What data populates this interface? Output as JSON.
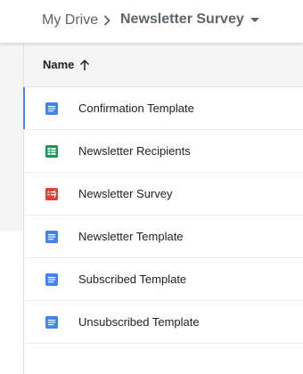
{
  "breadcrumb": {
    "root": "My Drive",
    "current": "Newsletter Survey"
  },
  "list": {
    "sort_label": "Name",
    "sort_direction": "ascending",
    "files": [
      {
        "name": "Confirmation Template",
        "type": "document",
        "selected": true
      },
      {
        "name": "Newsletter Recipients",
        "type": "spreadsheet",
        "selected": false
      },
      {
        "name": "Newsletter Survey",
        "type": "form",
        "selected": false
      },
      {
        "name": "Newsletter Template",
        "type": "document",
        "selected": false
      },
      {
        "name": "Subscribed Template",
        "type": "document",
        "selected": false
      },
      {
        "name": "Unsubscribed Template",
        "type": "document",
        "selected": false
      }
    ]
  },
  "colors": {
    "document": "#4285f4",
    "spreadsheet": "#0f9d58",
    "form": "#db4437",
    "selection": "#4285f4"
  },
  "icons": {
    "document": "doc-icon",
    "spreadsheet": "sheet-icon",
    "form": "form-icon"
  }
}
